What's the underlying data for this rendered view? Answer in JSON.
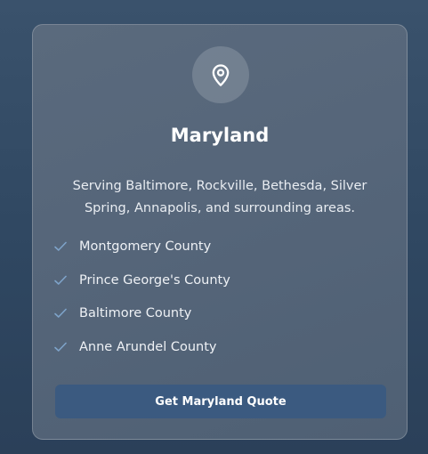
{
  "card": {
    "icon": "map-pin-icon",
    "title": "Maryland",
    "description": "Serving Baltimore, Rockville, Bethesda, Silver Spring, Annapolis, and surrounding areas.",
    "counties": [
      "Montgomery County",
      "Prince George's County",
      "Baltimore County",
      "Anne Arundel County"
    ],
    "check_icon": "check-icon",
    "button_label": "Get Maryland Quote"
  },
  "colors": {
    "page_background": "#344b65",
    "card_background": "#56667a",
    "button": "#3b5a80",
    "check": "#7ea3c9"
  }
}
